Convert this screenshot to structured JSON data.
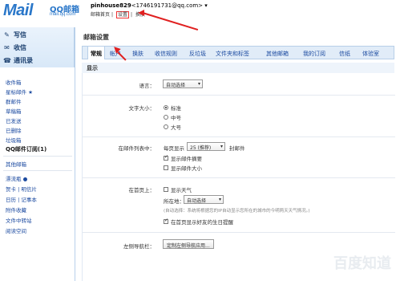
{
  "header": {
    "logo_text": "Mail",
    "logo_cn": "QQ邮箱",
    "logo_sub": "mail.qq.com",
    "account_name": "pinhouse829",
    "account_email": "<1746191731@qq.com>",
    "links": [
      "邮箱首页",
      "设置",
      "换肤"
    ],
    "separator": "|"
  },
  "leftnav": {
    "write": "写信",
    "receive": "收信",
    "contacts": "通讯录",
    "items": [
      "收件箱",
      "星标邮件 ★",
      "群邮件",
      "草稿箱",
      "已发送",
      "已删除",
      "垃圾箱",
      "QQ邮件订阅(1)",
      "其他邮箱",
      "漂流瓶 ●",
      "贺卡 | 明信片",
      "日历 | 记事本",
      "附件收藏",
      "文件中转站",
      "阅读空间"
    ]
  },
  "main": {
    "title": "邮箱设置",
    "tabs": [
      "常规",
      "帐户",
      "换肤",
      "收信规则",
      "反垃圾",
      "文件夹和标签",
      "其他邮箱",
      "我的订阅",
      "信纸",
      "体验室"
    ],
    "section": "显示",
    "language_label": "语言：",
    "language_value": "自动选择",
    "fontsize_label": "文字大小：",
    "fontsize_options": [
      "标准",
      "中号",
      "大号"
    ],
    "list_label": "在邮件列表中：",
    "per_page_prefix": "每页显示",
    "per_page_value": "25 (推荐)",
    "per_page_suffix": "封邮件",
    "show_summary": "显示邮件摘要",
    "show_size": "显示邮件大小",
    "home_label": "在首页上：",
    "show_weather": "显示天气",
    "location_label": "所在地：",
    "location_value": "自动选择",
    "weather_hint": "(自动选择：系统将根据您的IP自动显示您所在的城市的今明两天天气情况。)",
    "birthday_reminder": "在首页显示好友的生日提醒",
    "leftnav_label": "左侧导航栏：",
    "leftnav_button": "定制左侧导航应用..."
  },
  "watermark": "百度知道",
  "colors": {
    "accent": "#2a77c9",
    "tab_bg": "#e1ecf8",
    "arrow": "#e02020"
  }
}
